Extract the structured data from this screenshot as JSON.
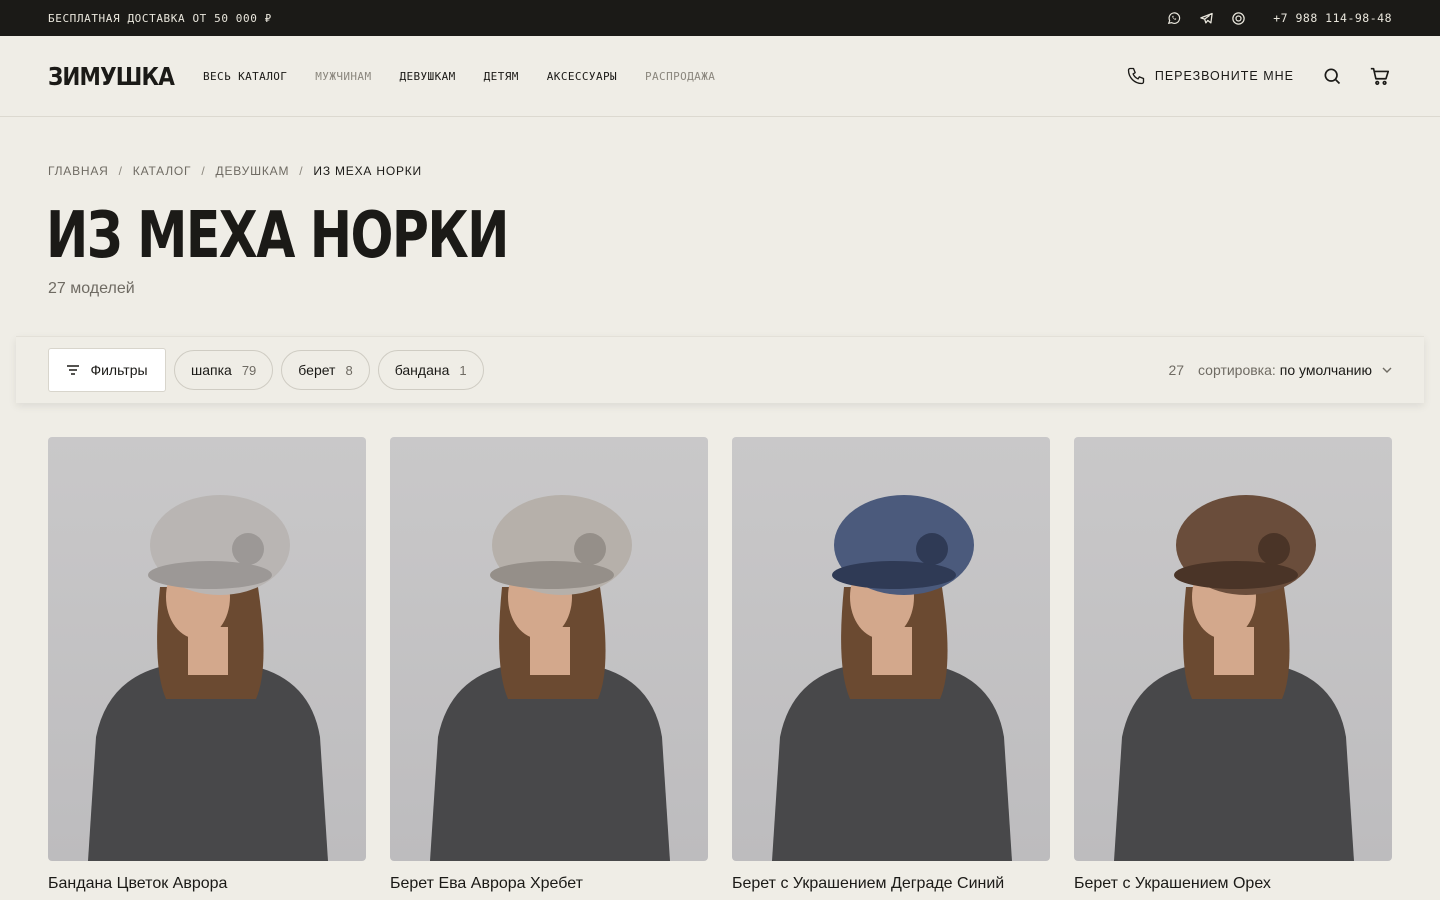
{
  "topbar": {
    "promo": "БЕСПЛАТНАЯ ДОСТАВКА ОТ 50 000 ₽",
    "phone": "+7 988 114-98-48",
    "icons": [
      "whatsapp-icon",
      "telegram-icon",
      "chat-icon"
    ]
  },
  "header": {
    "logo": "ЗИМУШКА",
    "nav": [
      "ВЕСЬ КАТАЛОГ",
      "МУЖЧИНАМ",
      "ДЕВУШКАМ",
      "ДЕТЯМ",
      "АКСЕССУАРЫ",
      "РАСПРОДАЖА"
    ],
    "callback_label": "ПЕРЕЗВОНИТЕ МНЕ"
  },
  "breadcrumb": [
    "ГЛАВНАЯ",
    "КАТАЛОГ",
    "ДЕВУШКАМ",
    "ИЗ МЕХА НОРКИ"
  ],
  "breadcrumb_sep": "/",
  "page": {
    "title": "ИЗ МЕХА НОРКИ",
    "count": "27 моделей"
  },
  "filters": {
    "button_label": "Фильтры",
    "chips": [
      {
        "label": "шапка",
        "count": "79"
      },
      {
        "label": "берет",
        "count": "8"
      },
      {
        "label": "бандана",
        "count": "1"
      }
    ],
    "total": "27",
    "sort_label": "сортировка:",
    "sort_value": "по умолчанию"
  },
  "products": [
    {
      "name": "Бандана Цветок Аврора",
      "hat_color": "#b9b5b3",
      "hat_shade": "#9c9896"
    },
    {
      "name": "Берет Ева Аврора Хребет",
      "hat_color": "#b6b0aa",
      "hat_shade": "#958f89"
    },
    {
      "name": "Берет с Украшением Деграде Синий",
      "hat_color": "#4b5a7c",
      "hat_shade": "#2f3a55"
    },
    {
      "name": "Берет с Украшением Орех",
      "hat_color": "#6a4d3b",
      "hat_shade": "#4a3427"
    }
  ],
  "colors": {
    "background": "#efede6",
    "dark": "#1b1a17",
    "muted": "#6f6b63",
    "sweater": "#48484a",
    "skin": "#d3a88c",
    "hair": "#6b4a31"
  }
}
